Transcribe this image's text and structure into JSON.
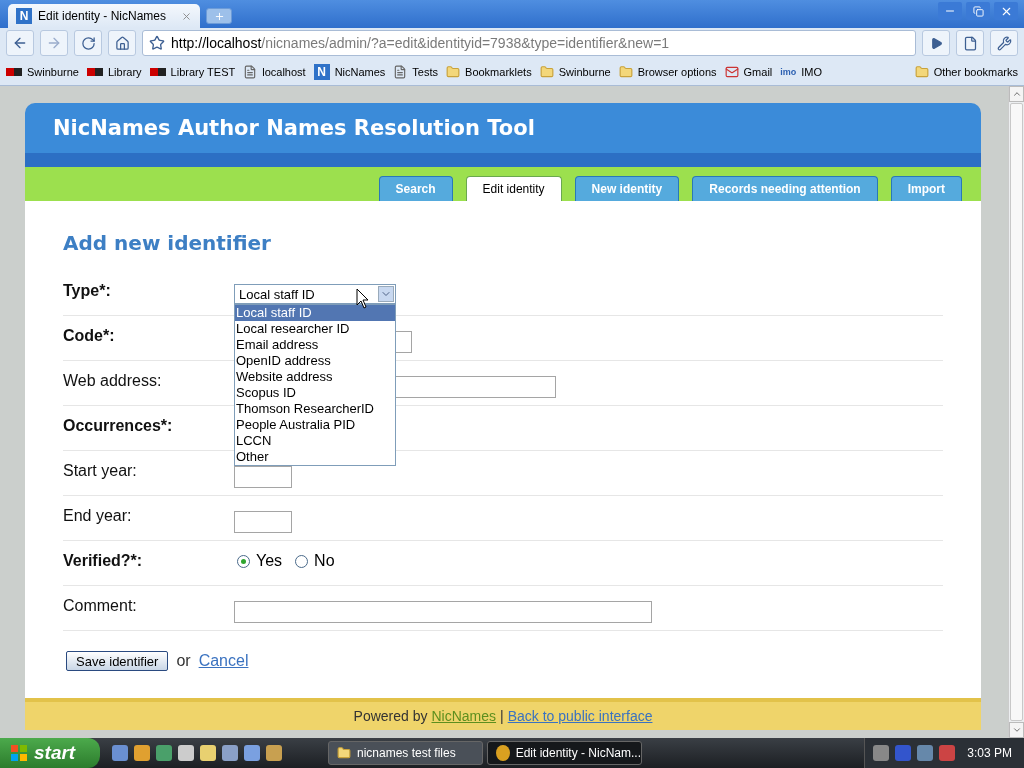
{
  "browser": {
    "tab_title": "Edit identity - NicNames",
    "url_host": "http://localhost",
    "url_path": "/nicnames/admin/?a=edit&identityid=7938&type=identifier&new=1",
    "bookmarks": [
      {
        "label": "Swinburne",
        "kind": "flag"
      },
      {
        "label": "Library",
        "kind": "flag"
      },
      {
        "label": "Library TEST",
        "kind": "flag"
      },
      {
        "label": "localhost",
        "kind": "page"
      },
      {
        "label": "NicNames",
        "kind": "app",
        "badge": "N"
      },
      {
        "label": "Tests",
        "kind": "page"
      },
      {
        "label": "Bookmarklets",
        "kind": "folder"
      },
      {
        "label": "Swinburne",
        "kind": "folder"
      },
      {
        "label": "Browser options",
        "kind": "folder"
      },
      {
        "label": "Gmail",
        "kind": "mail"
      },
      {
        "label": "IMO",
        "kind": "logo",
        "badge": "imo"
      }
    ],
    "other_bookmarks": "Other bookmarks",
    "tab_badge": "N"
  },
  "site": {
    "title": "NicNames Author Names Resolution Tool",
    "tabs": [
      {
        "label": "Search",
        "selected": false
      },
      {
        "label": "Edit identity",
        "selected": true
      },
      {
        "label": "New identity",
        "selected": false
      },
      {
        "label": "Records needing attention",
        "selected": false
      },
      {
        "label": "Import",
        "selected": false
      }
    ]
  },
  "form": {
    "heading": "Add new identifier",
    "rows": [
      {
        "kind": "select",
        "label": "Type*:",
        "bold": true,
        "value": "Local staff ID",
        "open": true,
        "options": [
          {
            "label": "Local staff ID",
            "selected": true
          },
          {
            "label": "Local researcher ID",
            "selected": false
          },
          {
            "label": "Email address",
            "selected": false
          },
          {
            "label": "OpenID address",
            "selected": false
          },
          {
            "label": "Website address",
            "selected": false
          },
          {
            "label": "Scopus ID",
            "selected": false
          },
          {
            "label": "Thomson ResearcherID",
            "selected": false
          },
          {
            "label": "People Australia PID",
            "selected": false
          },
          {
            "label": "LCCN",
            "selected": false
          },
          {
            "label": "Other",
            "selected": false
          }
        ]
      },
      {
        "kind": "text",
        "label": "Code*:",
        "bold": true
      },
      {
        "kind": "text",
        "label": "Web address:",
        "bold": false
      },
      {
        "kind": "covered",
        "label": "Occurrences*:",
        "bold": true
      },
      {
        "kind": "text",
        "label": "Start year:",
        "bold": false
      },
      {
        "kind": "text",
        "label": "End year:",
        "bold": false
      },
      {
        "kind": "radio",
        "label": "Verified?*:",
        "bold": true,
        "options": [
          {
            "label": "Yes",
            "selected": true
          },
          {
            "label": "No",
            "selected": false
          }
        ]
      },
      {
        "kind": "text",
        "label": "Comment:",
        "bold": false
      }
    ],
    "save_button": "Save identifier",
    "or": "or",
    "cancel": "Cancel"
  },
  "footer": {
    "powered_by": "Powered by",
    "app_link": "NicNames",
    "separator": "|",
    "public_link": "Back to public interface"
  },
  "taskbar": {
    "start": "start",
    "tasks": [
      {
        "label": "nicnames test files",
        "kind": "folder",
        "selected": false
      },
      {
        "label": "Edit identity - NicNam...",
        "kind": "browser",
        "selected": true
      }
    ],
    "clock": "3:03 PM"
  }
}
